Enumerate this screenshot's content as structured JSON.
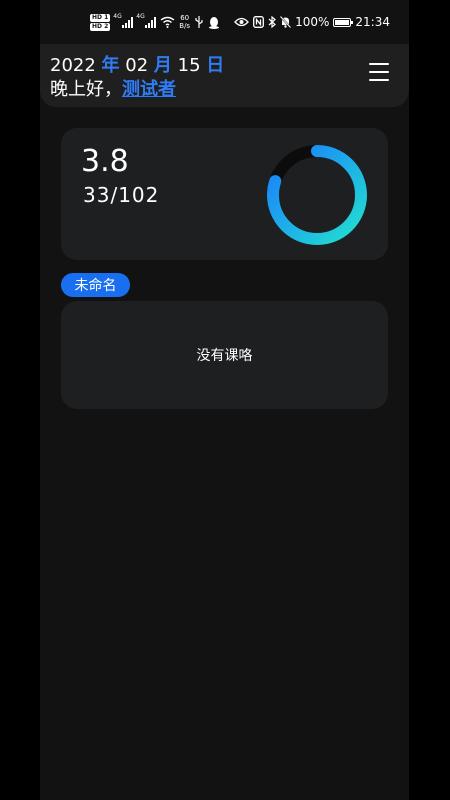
{
  "status_bar": {
    "hd1": "HD 1",
    "hd2": "HD 2",
    "sig1_label": "4G",
    "sig2_label": "4G",
    "speed_value": "60",
    "speed_unit": "B/s",
    "battery": "100%",
    "time": "21:34"
  },
  "header": {
    "year": "2022",
    "year_unit": "年",
    "month": "02",
    "month_unit": "月",
    "day": "15",
    "day_unit": "日",
    "greeting": "晚上好，",
    "username": "测试者"
  },
  "gpa_card": {
    "gpa": "3.8",
    "credits": "33/102",
    "progress": 0.8,
    "ring_colors": [
      "#22e0d0",
      "#1a7cff"
    ]
  },
  "semester_tag": "未命名",
  "course_card": {
    "empty_message": "没有课咯"
  },
  "colors": {
    "accent": "#2f7cf6",
    "background": "#121212",
    "card": "#1e1f21"
  }
}
